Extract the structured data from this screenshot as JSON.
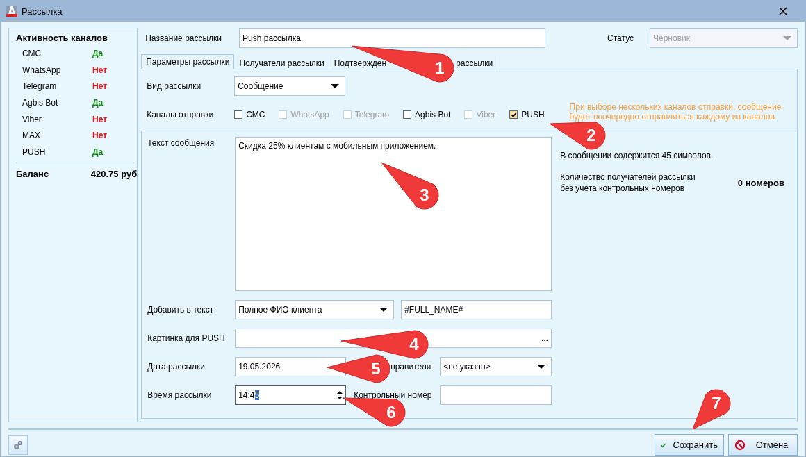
{
  "window": {
    "title": "Рассылка"
  },
  "channel_activity": {
    "title": "Активность каналов",
    "items": [
      {
        "name": "СМС",
        "value": "Да",
        "active": true
      },
      {
        "name": "WhatsApp",
        "value": "Нет",
        "active": false
      },
      {
        "name": "Telegram",
        "value": "Нет",
        "active": false
      },
      {
        "name": "Agbis Bot",
        "value": "Да",
        "active": true
      },
      {
        "name": "Viber",
        "value": "Нет",
        "active": false
      },
      {
        "name": "MAX",
        "value": "Нет",
        "active": false
      },
      {
        "name": "PUSH",
        "value": "Да",
        "active": true
      }
    ],
    "balance": {
      "label": "Баланс",
      "value": "420.75 руб"
    }
  },
  "name_field": {
    "label": "Название рассылки",
    "value": "Push рассылка"
  },
  "status_field": {
    "label": "Статус",
    "value": "Черновик",
    "disabled": true
  },
  "tabs": [
    {
      "label": "Параметры рассылки",
      "selected": true
    },
    {
      "label": "Получатели рассылки",
      "selected": false
    },
    {
      "label": "Подтвержден",
      "label_end": "рассылки",
      "selected": false
    }
  ],
  "type_field": {
    "label": "Вид рассылки",
    "value": "Сообщение"
  },
  "channels": {
    "label": "Каналы отправки",
    "items": [
      {
        "label": "СМС",
        "checked": false,
        "disabled": false
      },
      {
        "label": "WhatsApp",
        "checked": false,
        "disabled": true
      },
      {
        "label": "Telegram",
        "checked": false,
        "disabled": true
      },
      {
        "label": "Agbis Bot",
        "checked": false,
        "disabled": false
      },
      {
        "label": "Viber",
        "checked": false,
        "disabled": true
      },
      {
        "label": "PUSH",
        "checked": true,
        "disabled": false
      }
    ],
    "note": "При выборе нескольких каналов отправки, сообщение\nбудет поочередно отправляться каждому из каналов"
  },
  "message": {
    "label": "Текст сообщения",
    "value": "Скидка 25% клиентам с мобильным приложением.",
    "char_count": "В сообщении содержится 45 символов.",
    "recipients_label": "Количество получателей рассылки\nбез учета контрольных номеров",
    "recipients_value": "0 номеров"
  },
  "insert_field": {
    "label": "Добавить в текст",
    "value": "Полное ФИО клиента",
    "code": "#FULL_NAME#"
  },
  "image_field": {
    "label": "Картинка для PUSH",
    "button": "..."
  },
  "date_field": {
    "label": "Дата рассылки",
    "value": "19.05.2026"
  },
  "sender_field": {
    "label": "правителя",
    "value": "<не указан>"
  },
  "time_field": {
    "label": "Время рассылки",
    "value": "14:4",
    "selected_text": "5"
  },
  "control_number": {
    "label": "Контрольный номер"
  },
  "buttons": [
    {
      "label": "Сохранить",
      "kind": "save"
    },
    {
      "label": "Отмена",
      "kind": "cancel"
    }
  ],
  "callouts": [
    "1",
    "2",
    "3",
    "4",
    "5",
    "6",
    "7"
  ]
}
